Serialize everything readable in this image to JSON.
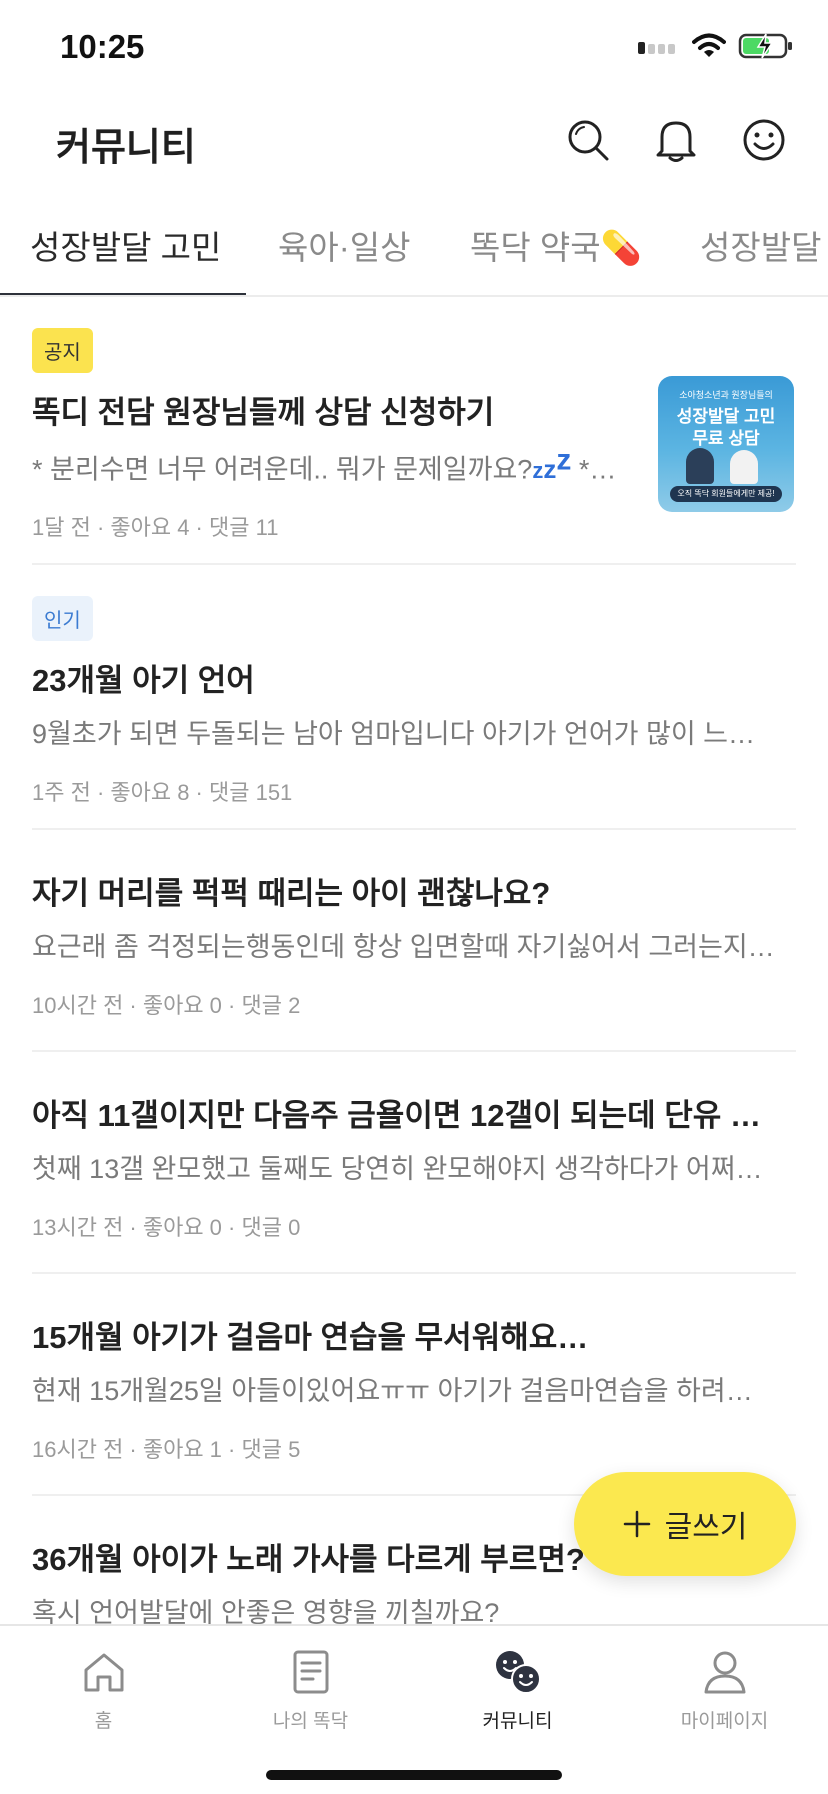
{
  "status": {
    "time": "10:25"
  },
  "header": {
    "title": "커뮤니티"
  },
  "tabs": [
    {
      "label": "성장발달 고민",
      "active": true
    },
    {
      "label": "육아·일상"
    },
    {
      "label": "똑닥 약국💊"
    },
    {
      "label": "성장발달 ·"
    }
  ],
  "posts": [
    {
      "badge": "공지",
      "title": "똑디 전담 원장님들께 상담 신청하기",
      "preview": "* 분리수면 너무 어려운데.. 뭐가 문제일까요?",
      "preview_tail": " *…",
      "meta": "1달 전 · 좋아요 4 · 댓글 11",
      "thumbnail": {
        "line1": "소아청소년과 원장님들의",
        "line2": "성장발달 고민",
        "line3": "무료 상담",
        "footer": "오직 똑닥 회원들에게만 제공!"
      }
    },
    {
      "badge": "인기",
      "title": "23개월 아기 언어",
      "preview": "9월초가 되면 두돌되는 남아 엄마입니다 아기가 언어가 많이 느…",
      "meta": "1주 전 · 좋아요 8 · 댓글 151"
    },
    {
      "title": "자기 머리를 퍽퍽 때리는 아이 괜찮나요?",
      "preview": "요근래 좀 걱정되는행동인데 항상 입면할때 자기싫어서 그러는지…",
      "meta": "10시간 전 · 좋아요 0 · 댓글 2"
    },
    {
      "title": "아직 11갤이지만 다음주 금욜이면 12갤이 되는데 단유 …",
      "preview": "첫째 13갤 완모했고 둘째도 당연히 완모해야지 생각하다가 어쩌…",
      "meta": "13시간 전 · 좋아요 0 · 댓글 0"
    },
    {
      "title": "15개월 아기가 걸음마 연습을 무서워해요…",
      "preview": "현재 15개월25일 아들이있어요ㅠㅠ 아기가 걸음마연습을 하려…",
      "meta": "16시간 전 · 좋아요 1 · 댓글 5"
    },
    {
      "title": "36개월 아이가 노래 가사를 다르게 부르면?",
      "preview": "혹시 언어발달에 안좋은 영향을 끼칠까요?"
    }
  ],
  "fab": {
    "label": "글쓰기"
  },
  "nav": [
    {
      "label": "홈",
      "icon": "home-icon"
    },
    {
      "label": "나의 똑닥",
      "icon": "document-icon"
    },
    {
      "label": "커뮤니티",
      "icon": "community-icon",
      "active": true
    },
    {
      "label": "마이페이지",
      "icon": "person-icon"
    }
  ],
  "colors": {
    "accent": "#fbe84f",
    "notice_badge": "#fbe34f",
    "popular_badge_bg": "#eaf2fb",
    "popular_badge_text": "#3b7bd1"
  }
}
